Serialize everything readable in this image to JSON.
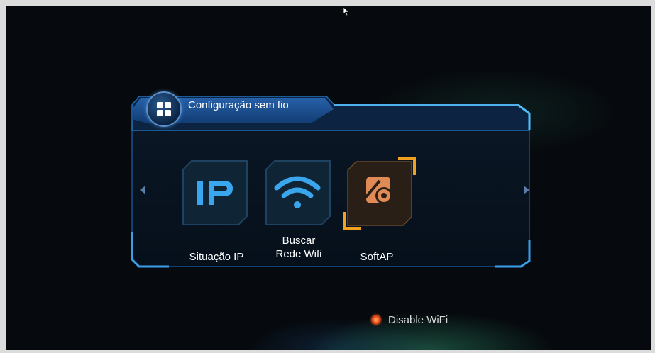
{
  "title": "Configuração sem fio",
  "menu": {
    "items": [
      {
        "label": "Situação IP",
        "icon": "ip-icon",
        "selected": false
      },
      {
        "label": "Buscar Rede Wifi",
        "label_line1": "Buscar",
        "label_line2": "Rede Wifi",
        "icon": "wifi-icon",
        "selected": false
      },
      {
        "label": "SoftAP",
        "icon": "softap-icon",
        "selected": true
      }
    ]
  },
  "hint": {
    "text": "Disable WiFi",
    "button": "red-button-icon"
  },
  "colors": {
    "accent": "#2f8fd6",
    "panel_border": "#1e6fb8",
    "selection": "#f2a020",
    "tile_icon": "#3aa6ee",
    "hint_button": "#e5501d"
  }
}
